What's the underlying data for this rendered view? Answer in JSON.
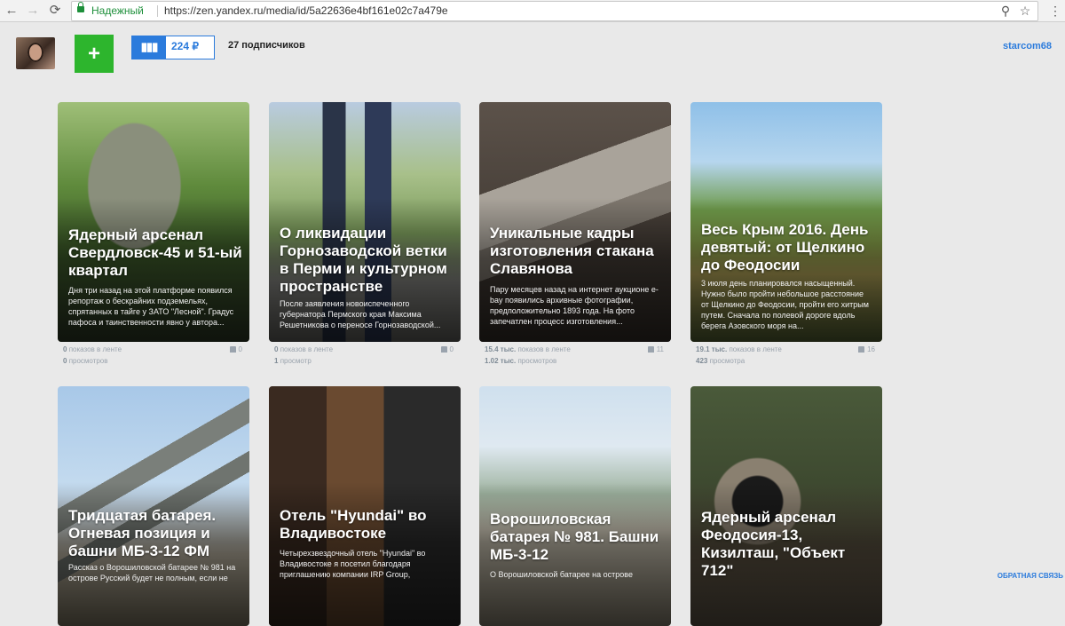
{
  "browser": {
    "secure_label": "Надежный",
    "url": "https://zen.yandex.ru/media/id/5a22636e4bf161e02c7a479e",
    "icons": [
      "back-arrow-icon",
      "forward-arrow-icon",
      "refresh-icon",
      "lock-icon",
      "zoom-icon",
      "star-icon",
      "menu-icon"
    ]
  },
  "header": {
    "add_label": "+",
    "wallet_icon": "▮▮▮",
    "balance": "224 ₽",
    "subscribers": "27 подписчиков",
    "username": "starcom68"
  },
  "cards": [
    {
      "title": "Ядерный арсенал Свердловск-45 и 51-ый квартал",
      "excerpt": "Дня три назад на этой платформе появился репортаж о бескрайних подземельях, спрятанных в тайге у ЗАТО \"Лесной\". Градус пафоса и таинственности явно у автора...",
      "views_count": "0",
      "views_label": "показов в ленте",
      "reads_count": "0",
      "reads_label": "просмотров",
      "likes": "0"
    },
    {
      "title": "О ликвидации Горнозаводской ветки в Перми и культурном пространстве",
      "excerpt": "После заявления новоиспеченного губернатора Пермского края Максима Решетникова о переносе Горнозаводской...",
      "views_count": "0",
      "views_label": "показов в ленте",
      "reads_count": "1",
      "reads_label": "просмотр",
      "likes": "0"
    },
    {
      "title": "Уникальные кадры изготовления стакана Славянова",
      "excerpt": "Пару месяцев назад на интернет аукционе e-bay появились архивные фотографии, предположительно 1893 года. На фото запечатлен процесс изготовления...",
      "views_count": "15.4 тыс.",
      "views_label": "показов в ленте",
      "reads_count": "1.02 тыс.",
      "reads_label": "просмотров",
      "likes": "11"
    },
    {
      "title": "Весь Крым 2016. День девятый: от Щелкино до Феодосии",
      "excerpt": "3 июля день планировался насыщенный. Нужно было пройти небольшое расстояние от Щелкино до Феодосии, пройти его хитрым путем. Сначала по полевой дороге вдоль берега Азовского моря на...",
      "views_count": "19.1 тыс.",
      "views_label": "показов в ленте",
      "reads_count": "423",
      "reads_label": "просмотра",
      "likes": "16"
    },
    {
      "title": "Тридцатая батарея. Огневая позиция и башни МБ-3-12 ФМ",
      "excerpt": "Рассказ о Ворошиловской батарее № 981 на острове Русский будет не полным, если не"
    },
    {
      "title": "Отель \"Hyundai\" во Владивостоке",
      "excerpt": "Четырехзвездочный отель \"Hyundai\" во Владивостоке я посетил благодаря приглашению компании IRP Group,"
    },
    {
      "title": "Ворошиловская батарея № 981. Башни МБ-3-12",
      "excerpt": "О Ворошиловской батарее на острове"
    },
    {
      "title": "Ядерный арсенал Феодосия-13, Кизилташ, \"Объект 712\"",
      "excerpt": ""
    }
  ],
  "footer": {
    "feedback": "ОБРАТНАЯ СВЯЗЬ"
  }
}
